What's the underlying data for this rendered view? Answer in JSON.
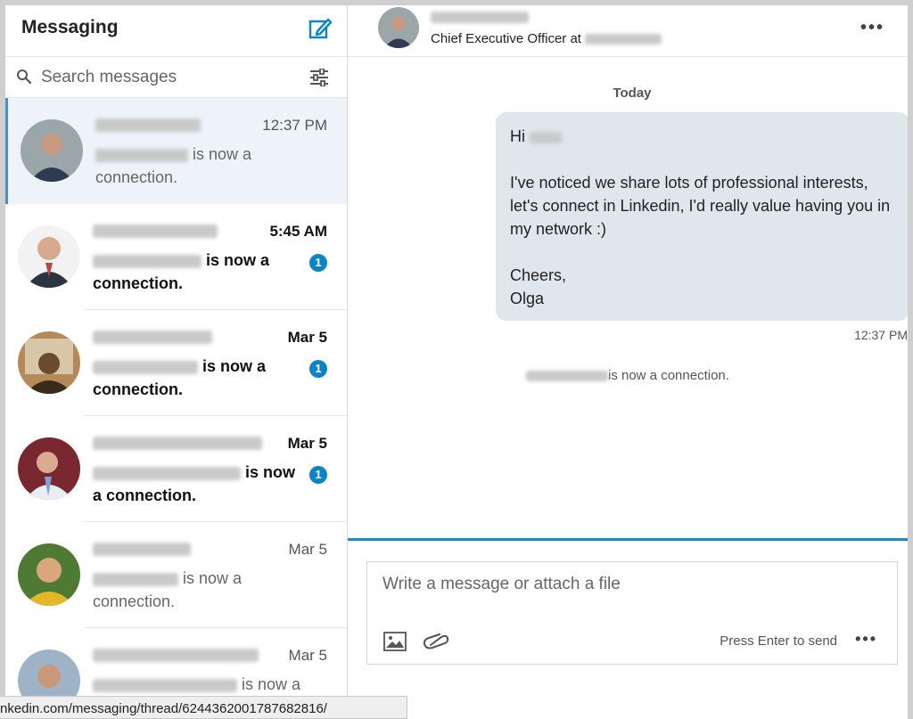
{
  "sidebar": {
    "title": "Messaging",
    "search_placeholder": "Search messages",
    "conversations": [
      {
        "time": "12:37 PM",
        "preview": "is now a connection.",
        "unread": false,
        "badge": ""
      },
      {
        "time": "5:45 AM",
        "preview": "is now a connection.",
        "unread": true,
        "badge": "1"
      },
      {
        "time": "Mar 5",
        "preview": "is now a connection.",
        "unread": true,
        "badge": "1"
      },
      {
        "time": "Mar 5",
        "preview": "is now a connection.",
        "unread": true,
        "badge": "1"
      },
      {
        "time": "Mar 5",
        "preview": "is now a connection.",
        "unread": false,
        "badge": ""
      },
      {
        "time": "Mar 5",
        "preview": "is now a",
        "unread": false,
        "badge": ""
      }
    ]
  },
  "thread": {
    "subtitle": "Chief Executive Officer at",
    "day_label": "Today",
    "message_greeting": "Hi",
    "message_body": "I've noticed we share lots of professional interests, let's connect in Linkedin, I'd really value having you in my network :)",
    "message_signoff_line1": "Cheers,",
    "message_signoff_line2": "Olga",
    "message_time": "12:37 PM",
    "connection_note": "is now a connection."
  },
  "composer": {
    "placeholder": "Write a message or attach a file",
    "hint": "Press Enter to send"
  },
  "status_url": "nkedin.com/messaging/thread/6244362001787682816/",
  "colors": {
    "accent": "#1e88c8",
    "badge": "#0a84c4",
    "bubble": "#dfe6ec"
  }
}
